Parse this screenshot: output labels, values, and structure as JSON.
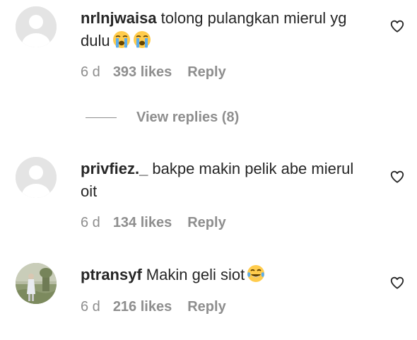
{
  "comments": [
    {
      "username": "nrlnjwaisa",
      "text": "tolong pulangkan mierul yg dulu",
      "emoji": [
        "loudly-crying-face",
        "loudly-crying-face"
      ],
      "time": "6 d",
      "likes": "393 likes",
      "reply": "Reply",
      "view_replies": "View replies (8)"
    },
    {
      "username": "privfiez._",
      "text": "bakpe makin pelik abe mierul oit",
      "time": "6 d",
      "likes": "134 likes",
      "reply": "Reply"
    },
    {
      "username": "ptransyf",
      "text": "Makin geli siot",
      "emoji": [
        "face-with-tears-of-joy"
      ],
      "time": "6 d",
      "likes": "216 likes",
      "reply": "Reply"
    }
  ],
  "icons": {
    "like": "heart-outline-icon",
    "avatar_default": "default-avatar-icon"
  },
  "colors": {
    "text": "#262626",
    "secondary": "#8e8e8e",
    "avatar_placeholder": "#e4e4e4"
  }
}
